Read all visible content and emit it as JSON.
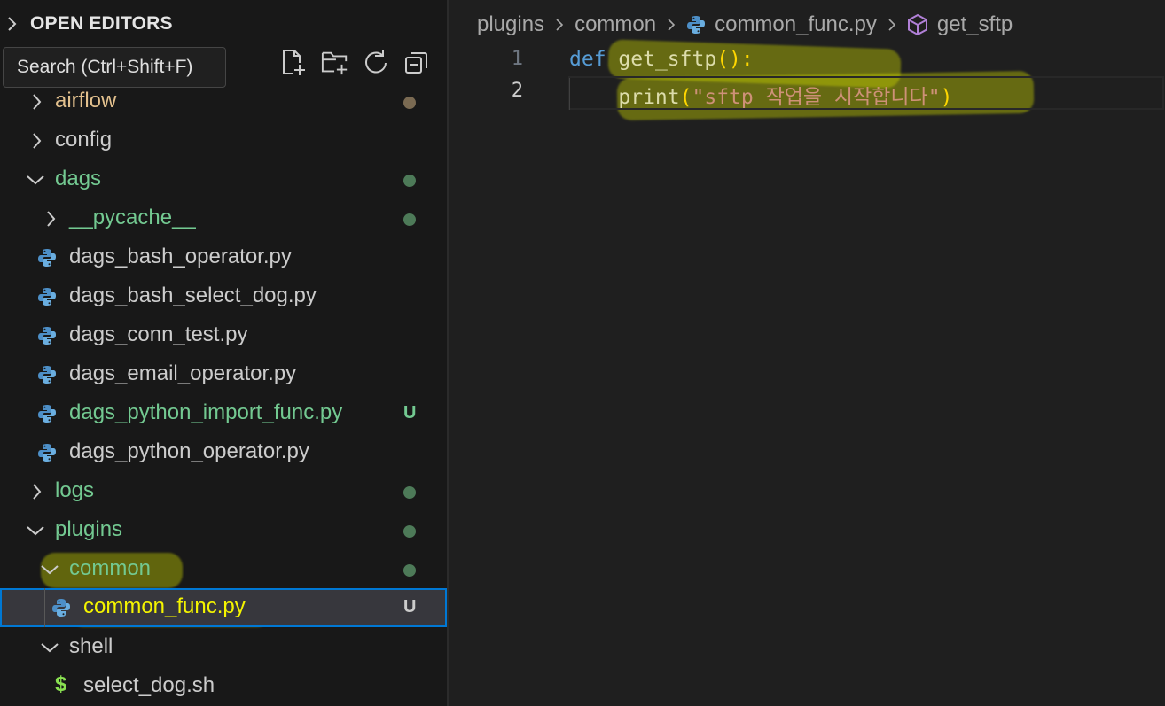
{
  "explorer": {
    "section_title": "OPEN EDITORS",
    "tooltip": "Search (Ctrl+Shift+F)",
    "actions": [
      "new-file-icon",
      "new-folder-icon",
      "refresh-icon",
      "collapse-all-icon"
    ],
    "items": [
      {
        "label": "airflow",
        "type": "folder",
        "expanded": false,
        "status": "dot-modified"
      },
      {
        "label": "config",
        "type": "folder",
        "expanded": false,
        "status": ""
      },
      {
        "label": "dags",
        "type": "folder",
        "expanded": true,
        "status": "dot-untracked"
      },
      {
        "label": "__pycache__",
        "type": "folder",
        "expanded": false,
        "status": "dot-untracked"
      },
      {
        "label": "dags_bash_operator.py",
        "type": "python-file",
        "status": ""
      },
      {
        "label": "dags_bash_select_dog.py",
        "type": "python-file",
        "status": ""
      },
      {
        "label": "dags_conn_test.py",
        "type": "python-file",
        "status": ""
      },
      {
        "label": "dags_email_operator.py",
        "type": "python-file",
        "status": ""
      },
      {
        "label": "dags_python_import_func.py",
        "type": "python-file",
        "status": "U"
      },
      {
        "label": "dags_python_operator.py",
        "type": "python-file",
        "status": ""
      },
      {
        "label": "logs",
        "type": "folder",
        "expanded": false,
        "status": "dot-untracked"
      },
      {
        "label": "plugins",
        "type": "folder",
        "expanded": true,
        "status": "dot-untracked"
      },
      {
        "label": "common",
        "type": "folder",
        "expanded": true,
        "status": "dot-untracked"
      },
      {
        "label": "common_func.py",
        "type": "python-file",
        "status": "U",
        "selected": true
      },
      {
        "label": "shell",
        "type": "folder",
        "expanded": true,
        "status": ""
      },
      {
        "label": "select_dog.sh",
        "type": "shell-file",
        "status": ""
      }
    ],
    "badge_u": "U"
  },
  "breadcrumb": {
    "parts": [
      "plugins",
      "common",
      "common_func.py",
      "get_sftp"
    ]
  },
  "code": {
    "line_numbers": [
      "1",
      "2"
    ],
    "line1": {
      "kw": "def",
      "fn": "get_sftp",
      "paren": "():"
    },
    "line2": {
      "indent": "    ",
      "fn": "print",
      "open": "(",
      "str": "\"sftp 작업을 시작합니다\"",
      "close": ")"
    }
  },
  "colors": {
    "accent": "#0078d4",
    "untracked": "#73c991",
    "modified": "#e2c08d",
    "highlight": "#c8d200"
  }
}
